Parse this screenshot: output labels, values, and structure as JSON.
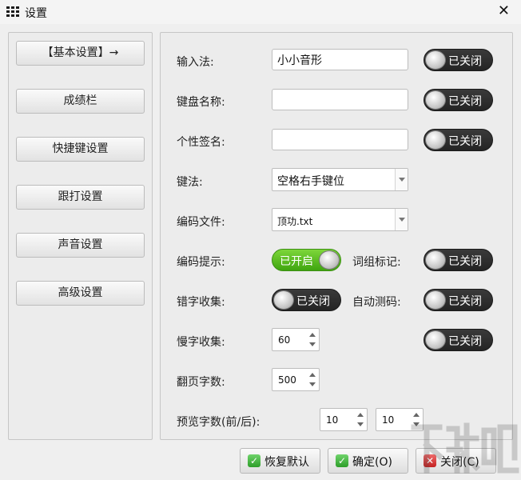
{
  "window": {
    "title": "设置",
    "close_icon": "close-icon"
  },
  "nav": {
    "items": [
      {
        "label": "【基本设置】→"
      },
      {
        "label": "成绩栏"
      },
      {
        "label": "快捷键设置"
      },
      {
        "label": "跟打设置"
      },
      {
        "label": "声音设置"
      },
      {
        "label": "高级设置"
      }
    ]
  },
  "form": {
    "input_method": {
      "label": "输入法:",
      "value": "小小音形",
      "toggle": "已关闭"
    },
    "keyboard_name": {
      "label": "键盘名称:",
      "value": "",
      "toggle": "已关闭"
    },
    "signature": {
      "label": "个性签名:",
      "value": "",
      "toggle": "已关闭"
    },
    "key_method": {
      "label": "键法:",
      "value": "空格右手键位"
    },
    "code_file": {
      "label": "编码文件:",
      "value": "顶功.txt"
    },
    "code_hint": {
      "label": "编码提示:",
      "toggle": "已开启"
    },
    "phrase_mark": {
      "label": "词组标记:",
      "toggle": "已关闭"
    },
    "typo_collect": {
      "label": "错字收集:",
      "toggle": "已关闭"
    },
    "auto_code": {
      "label": "自动测码:",
      "toggle": "已关闭"
    },
    "slow_collect": {
      "label": "慢字收集:",
      "value": "60",
      "toggle": "已关闭"
    },
    "page_count": {
      "label": "翻页字数:",
      "value": "500"
    },
    "preview_count": {
      "label": "预览字数(前/后):",
      "before": "10",
      "after": "10"
    }
  },
  "footer": {
    "restore_label": "恢复默认",
    "ok_label": "确定(O)",
    "close_label": "关闭(C)"
  },
  "colors": {
    "toggle_on": "#4fb81c",
    "toggle_off": "#2b2b2b",
    "ok_icon": "#3ab436",
    "close_icon": "#d93030"
  }
}
